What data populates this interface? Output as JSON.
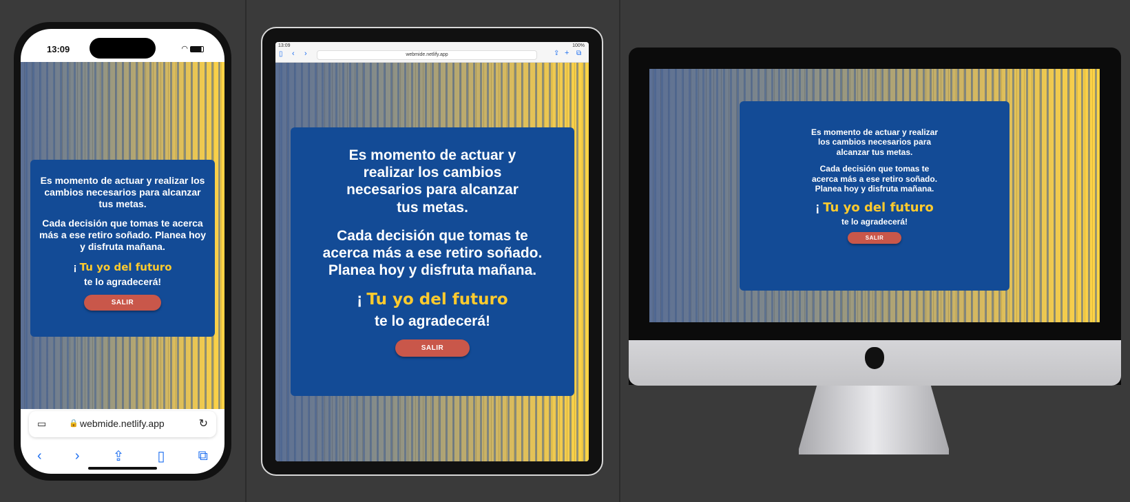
{
  "phone": {
    "time": "13:09",
    "url": "webmide.netlify.app"
  },
  "tablet": {
    "time": "13:09",
    "battery": "100%",
    "url": "webmide.netlify.app"
  },
  "card": {
    "line1": "Es momento de actuar y realizar los cambios necesarios para alcanzar tus metas.",
    "line2": "Cada decisión que tomas te acerca más a ese retiro soñado. Planea hoy y disfruta mañana.",
    "exclaim": "¡",
    "future": "Tu yo del futuro",
    "thanks": "te lo agradecerá!",
    "button": "SALIR"
  },
  "colors": {
    "card_bg": "#134b96",
    "accent_yellow": "#ffcb2e",
    "button_red": "#c9574a"
  }
}
